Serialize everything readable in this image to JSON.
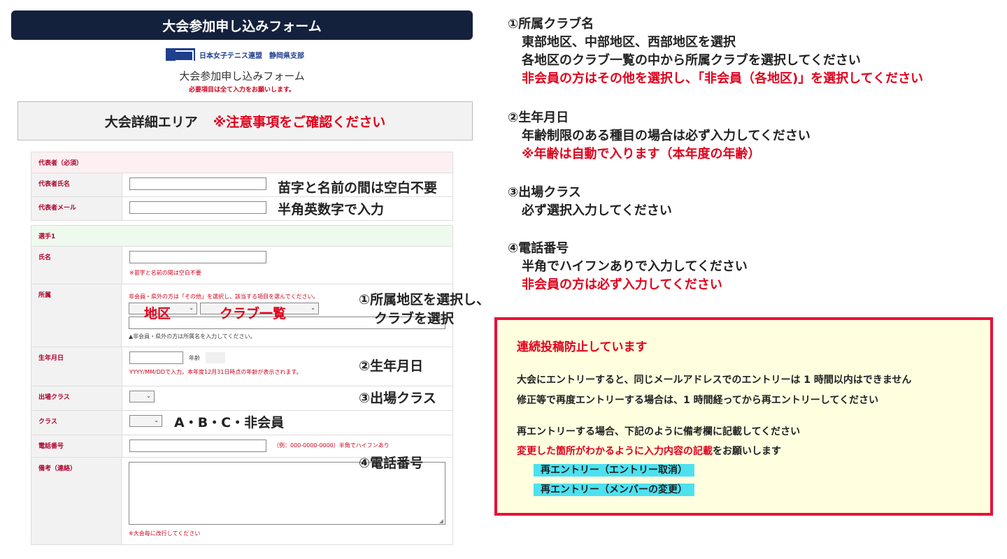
{
  "header": {
    "title": "大会参加申し込みフォーム"
  },
  "logo": {
    "text": "日本女子テニス連盟　静岡県支部"
  },
  "form_title": "大会参加申し込みフォーム",
  "required_note": "必要項目は全て入力をお願いします。",
  "details_box": {
    "label": "大会詳細エリア",
    "warning": "※注意事項をご確認ください"
  },
  "representative": {
    "section": "代表者（必須）",
    "name_label": "代表者氏名",
    "email_label": "代表者メール"
  },
  "player1": {
    "section": "選手1",
    "name_label": "氏名",
    "name_note": "※苗字と名前の間は空白不要",
    "affil_label": "所属",
    "affil_note": "非会員・県外の方は「その他」を選択し、該当する項目を選んでください。",
    "affil_note2": "▲非会員・県外の方は所属名を入力してください。",
    "birth_label": "生年月日",
    "age_label": "年齢",
    "birth_note": "YYYY/MM/DDで入力。本年度12月31日時点の年齢が表示されます。",
    "entry_class_label": "出場クラス",
    "class_label": "クラス",
    "phone_label": "電話番号",
    "phone_note": "（例：000-0000-0000）半角でハイフンあり",
    "remarks_label": "備考（連絡）",
    "remarks_note": "※大会毎に改行してください"
  },
  "annotations": {
    "name_hint": "苗字と名前の間は空白不要",
    "email_hint": "半角英数字で入力",
    "region": "地区",
    "club_list": "クラブ一覧",
    "affil_hint_1": "①所属地区を選択し、",
    "affil_hint_2": "クラブを選択",
    "birth_hint": "②生年月日",
    "entry_class_hint": "③出場クラス",
    "class_hint": "A・B・C・非会員",
    "phone_hint": "④電話番号"
  },
  "instructions": {
    "i1_title": "①所属クラブ名",
    "i1_line1": "東部地区、中部地区、西部地区を選択",
    "i1_line2": "各地区のクラブ一覧の中から所属クラブを選択してください",
    "i1_line3": "非会員の方はその他を選択し、「非会員（各地区)」を選択してください",
    "i2_title": "②生年月日",
    "i2_line1": "年齢制限のある種目の場合は必ず入力してください",
    "i2_line2": "※年齢は自動で入ります（本年度の年齢）",
    "i3_title": "③出場クラス",
    "i3_line1": "必ず選択入力してください",
    "i4_title": "④電話番号",
    "i4_line1": "半角でハイフンありで入力してください",
    "i4_line2": "非会員の方は必ず入力してください"
  },
  "notice": {
    "title": "連続投稿防止しています",
    "line1": "大会にエントリーすると、同じメールアドレスでのエントリーは 1 時間以内はできません",
    "line2": "修正等で再度エントリーする場合は、1 時間経ってから再エントリーしてください",
    "line3": "再エントリーする場合、下記のように備考欄に記載してください",
    "line4_red": "変更した箇所がわかるように入力内容の記載",
    "line4_rest": "をお願いします",
    "example1": "再エントリー（エントリー取消）",
    "example2": "再エントリー（メンバーの変更）"
  },
  "colors": {
    "header_bg": "#14213d",
    "accent_red": "#e0001b",
    "notice_border": "#e8113c",
    "notice_bg": "#ffffe0",
    "highlight": "#4de1f0",
    "rep_section_bg": "#fdf0f3",
    "player_section_bg": "#eefaee"
  }
}
